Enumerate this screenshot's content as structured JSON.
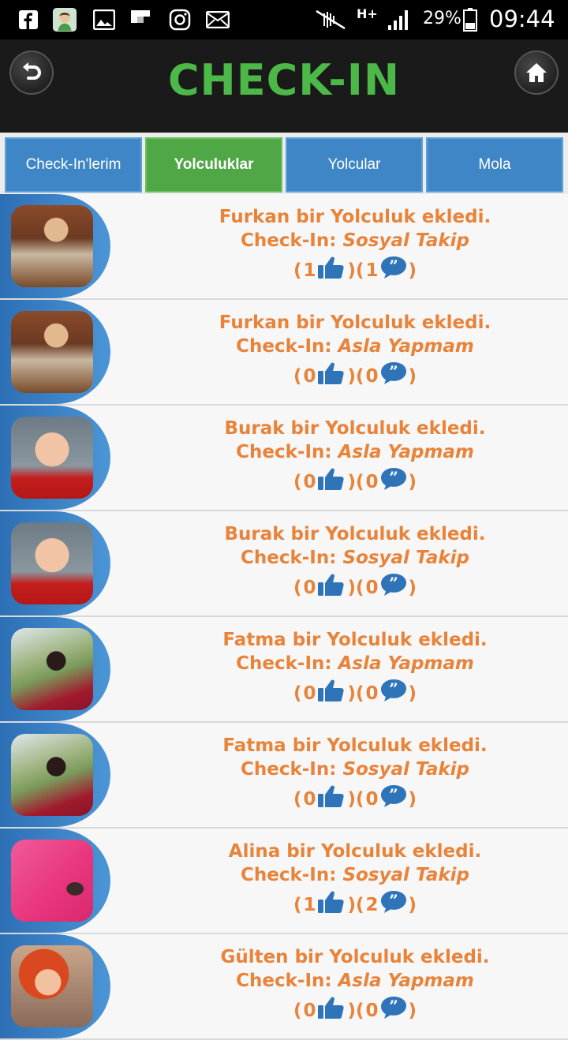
{
  "status": {
    "battery": "29%",
    "time": "09:44",
    "network": "H+"
  },
  "header": {
    "logo": "CHECK-IN"
  },
  "tabs": [
    {
      "label": "Check-In'lerim",
      "active": false
    },
    {
      "label": "Yolculuklar",
      "active": true
    },
    {
      "label": "Yolcular",
      "active": false
    },
    {
      "label": "Mola",
      "active": false
    }
  ],
  "feed": [
    {
      "title": "Furkan bir Yolculuk ekledi.",
      "ci_prefix": "Check-In: ",
      "ci_value": "Sosyal Takip",
      "likes": "1",
      "comments": "1"
    },
    {
      "title": "Furkan bir Yolculuk ekledi.",
      "ci_prefix": "Check-In: ",
      "ci_value": "Asla Yapmam",
      "likes": "0",
      "comments": "0"
    },
    {
      "title": "Burak bir Yolculuk ekledi.",
      "ci_prefix": "Check-In: ",
      "ci_value": "Asla Yapmam",
      "likes": "0",
      "comments": "0"
    },
    {
      "title": "Burak bir Yolculuk ekledi.",
      "ci_prefix": "Check-In: ",
      "ci_value": "Sosyal Takip",
      "likes": "0",
      "comments": "0"
    },
    {
      "title": "Fatma bir Yolculuk ekledi.",
      "ci_prefix": "Check-In: ",
      "ci_value": "Asla Yapmam",
      "likes": "0",
      "comments": "0"
    },
    {
      "title": "Fatma bir Yolculuk ekledi.",
      "ci_prefix": "Check-In: ",
      "ci_value": "Sosyal Takip",
      "likes": "0",
      "comments": "0"
    },
    {
      "title": "Alina bir Yolculuk ekledi.",
      "ci_prefix": "Check-In: ",
      "ci_value": "Sosyal Takip",
      "likes": "1",
      "comments": "2"
    },
    {
      "title": "Gülten bir Yolculuk ekledi.",
      "ci_prefix": "Check-In: ",
      "ci_value": "Asla Yapmam",
      "likes": "0",
      "comments": "0"
    }
  ],
  "colors": {
    "accent_orange": "#e8833a",
    "tab_blue": "#3e86c6",
    "tab_active_green": "#4fa845",
    "logo_green": "#4cb848"
  }
}
